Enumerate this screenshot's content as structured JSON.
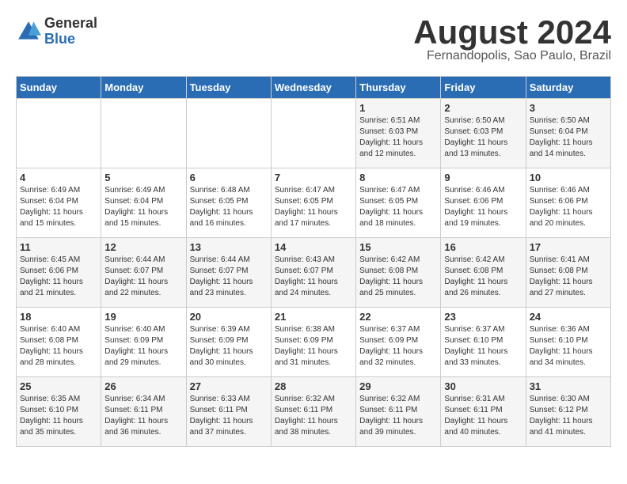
{
  "header": {
    "logo_general": "General",
    "logo_blue": "Blue",
    "month_title": "August 2024",
    "location": "Fernandopolis, Sao Paulo, Brazil"
  },
  "days_of_week": [
    "Sunday",
    "Monday",
    "Tuesday",
    "Wednesday",
    "Thursday",
    "Friday",
    "Saturday"
  ],
  "weeks": [
    [
      {
        "day": "",
        "info": ""
      },
      {
        "day": "",
        "info": ""
      },
      {
        "day": "",
        "info": ""
      },
      {
        "day": "",
        "info": ""
      },
      {
        "day": "1",
        "info": "Sunrise: 6:51 AM\nSunset: 6:03 PM\nDaylight: 11 hours\nand 12 minutes."
      },
      {
        "day": "2",
        "info": "Sunrise: 6:50 AM\nSunset: 6:03 PM\nDaylight: 11 hours\nand 13 minutes."
      },
      {
        "day": "3",
        "info": "Sunrise: 6:50 AM\nSunset: 6:04 PM\nDaylight: 11 hours\nand 14 minutes."
      }
    ],
    [
      {
        "day": "4",
        "info": "Sunrise: 6:49 AM\nSunset: 6:04 PM\nDaylight: 11 hours\nand 15 minutes."
      },
      {
        "day": "5",
        "info": "Sunrise: 6:49 AM\nSunset: 6:04 PM\nDaylight: 11 hours\nand 15 minutes."
      },
      {
        "day": "6",
        "info": "Sunrise: 6:48 AM\nSunset: 6:05 PM\nDaylight: 11 hours\nand 16 minutes."
      },
      {
        "day": "7",
        "info": "Sunrise: 6:47 AM\nSunset: 6:05 PM\nDaylight: 11 hours\nand 17 minutes."
      },
      {
        "day": "8",
        "info": "Sunrise: 6:47 AM\nSunset: 6:05 PM\nDaylight: 11 hours\nand 18 minutes."
      },
      {
        "day": "9",
        "info": "Sunrise: 6:46 AM\nSunset: 6:06 PM\nDaylight: 11 hours\nand 19 minutes."
      },
      {
        "day": "10",
        "info": "Sunrise: 6:46 AM\nSunset: 6:06 PM\nDaylight: 11 hours\nand 20 minutes."
      }
    ],
    [
      {
        "day": "11",
        "info": "Sunrise: 6:45 AM\nSunset: 6:06 PM\nDaylight: 11 hours\nand 21 minutes."
      },
      {
        "day": "12",
        "info": "Sunrise: 6:44 AM\nSunset: 6:07 PM\nDaylight: 11 hours\nand 22 minutes."
      },
      {
        "day": "13",
        "info": "Sunrise: 6:44 AM\nSunset: 6:07 PM\nDaylight: 11 hours\nand 23 minutes."
      },
      {
        "day": "14",
        "info": "Sunrise: 6:43 AM\nSunset: 6:07 PM\nDaylight: 11 hours\nand 24 minutes."
      },
      {
        "day": "15",
        "info": "Sunrise: 6:42 AM\nSunset: 6:08 PM\nDaylight: 11 hours\nand 25 minutes."
      },
      {
        "day": "16",
        "info": "Sunrise: 6:42 AM\nSunset: 6:08 PM\nDaylight: 11 hours\nand 26 minutes."
      },
      {
        "day": "17",
        "info": "Sunrise: 6:41 AM\nSunset: 6:08 PM\nDaylight: 11 hours\nand 27 minutes."
      }
    ],
    [
      {
        "day": "18",
        "info": "Sunrise: 6:40 AM\nSunset: 6:08 PM\nDaylight: 11 hours\nand 28 minutes."
      },
      {
        "day": "19",
        "info": "Sunrise: 6:40 AM\nSunset: 6:09 PM\nDaylight: 11 hours\nand 29 minutes."
      },
      {
        "day": "20",
        "info": "Sunrise: 6:39 AM\nSunset: 6:09 PM\nDaylight: 11 hours\nand 30 minutes."
      },
      {
        "day": "21",
        "info": "Sunrise: 6:38 AM\nSunset: 6:09 PM\nDaylight: 11 hours\nand 31 minutes."
      },
      {
        "day": "22",
        "info": "Sunrise: 6:37 AM\nSunset: 6:09 PM\nDaylight: 11 hours\nand 32 minutes."
      },
      {
        "day": "23",
        "info": "Sunrise: 6:37 AM\nSunset: 6:10 PM\nDaylight: 11 hours\nand 33 minutes."
      },
      {
        "day": "24",
        "info": "Sunrise: 6:36 AM\nSunset: 6:10 PM\nDaylight: 11 hours\nand 34 minutes."
      }
    ],
    [
      {
        "day": "25",
        "info": "Sunrise: 6:35 AM\nSunset: 6:10 PM\nDaylight: 11 hours\nand 35 minutes."
      },
      {
        "day": "26",
        "info": "Sunrise: 6:34 AM\nSunset: 6:11 PM\nDaylight: 11 hours\nand 36 minutes."
      },
      {
        "day": "27",
        "info": "Sunrise: 6:33 AM\nSunset: 6:11 PM\nDaylight: 11 hours\nand 37 minutes."
      },
      {
        "day": "28",
        "info": "Sunrise: 6:32 AM\nSunset: 6:11 PM\nDaylight: 11 hours\nand 38 minutes."
      },
      {
        "day": "29",
        "info": "Sunrise: 6:32 AM\nSunset: 6:11 PM\nDaylight: 11 hours\nand 39 minutes."
      },
      {
        "day": "30",
        "info": "Sunrise: 6:31 AM\nSunset: 6:11 PM\nDaylight: 11 hours\nand 40 minutes."
      },
      {
        "day": "31",
        "info": "Sunrise: 6:30 AM\nSunset: 6:12 PM\nDaylight: 11 hours\nand 41 minutes."
      }
    ]
  ]
}
